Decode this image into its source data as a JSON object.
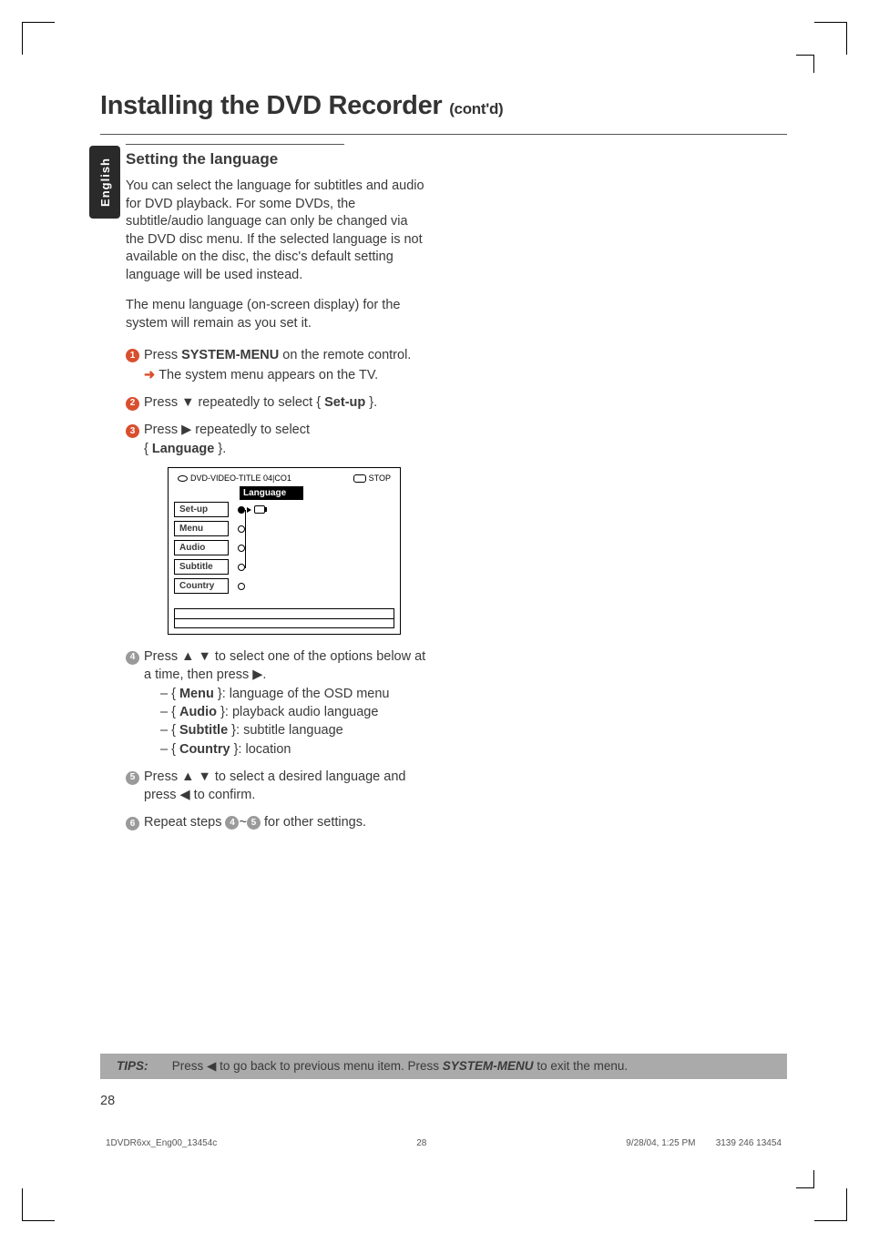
{
  "lang_tab": "English",
  "title_main": "Installing the DVD Recorder",
  "title_contd": "(cont'd)",
  "section": {
    "heading": "Setting the language",
    "p1": "You can select the language for subtitles and audio for DVD playback.  For some DVDs, the subtitle/audio language can only be changed via the DVD disc menu.  If the selected language is not available on the disc, the disc's default setting language will be used instead.",
    "p2": "The menu language (on-screen display) for the system will remain as you set it.",
    "step1_a": "Press ",
    "step1_b": "SYSTEM-MENU",
    "step1_c": " on the remote control.",
    "step1_sub": "The system menu appears on the TV.",
    "step2_a": "Press ▼ repeatedly to select { ",
    "step2_b": "Set-up",
    "step2_c": " }.",
    "step3_a": "Press ▶ repeatedly to select",
    "step3_b": "Language",
    "step3_c": "{ ",
    "step3_d": " }.",
    "step4_a": "Press ▲ ▼ to select one of the options below at a time, then press ▶.",
    "bullets": [
      {
        "pre": "–  { ",
        "term": "Menu",
        "post": " }: language of the OSD menu"
      },
      {
        "pre": "–  { ",
        "term": "Audio",
        "post": " }: playback audio language"
      },
      {
        "pre": "–  { ",
        "term": "Subtitle",
        "post": " }: subtitle language"
      },
      {
        "pre": "–  { ",
        "term": "Country",
        "post": " }: location"
      }
    ],
    "step5_a": "Press ▲ ▼ to select a desired language and press ◀ to confirm.",
    "step6_a": "Repeat steps ",
    "step6_b": "~",
    "step6_c": " for other settings."
  },
  "menu_fig": {
    "header_left": "DVD-VIDEO-TITLE 04|CO1",
    "header_right": "STOP",
    "strip": "Language",
    "rows": [
      "Set-up",
      "Menu",
      "Audio",
      "Subtitle",
      "Country"
    ]
  },
  "tips": {
    "label": "TIPS:",
    "text_a": "Press ◀ to go back to previous menu item.  Press ",
    "text_b": "SYSTEM-MENU",
    "text_c": " to exit the menu."
  },
  "page_number": "28",
  "footer": {
    "left": "1DVDR6xx_Eng00_13454c",
    "center": "28",
    "right_date": "9/28/04, 1:25 PM",
    "right_code": "3139 246 13454"
  }
}
